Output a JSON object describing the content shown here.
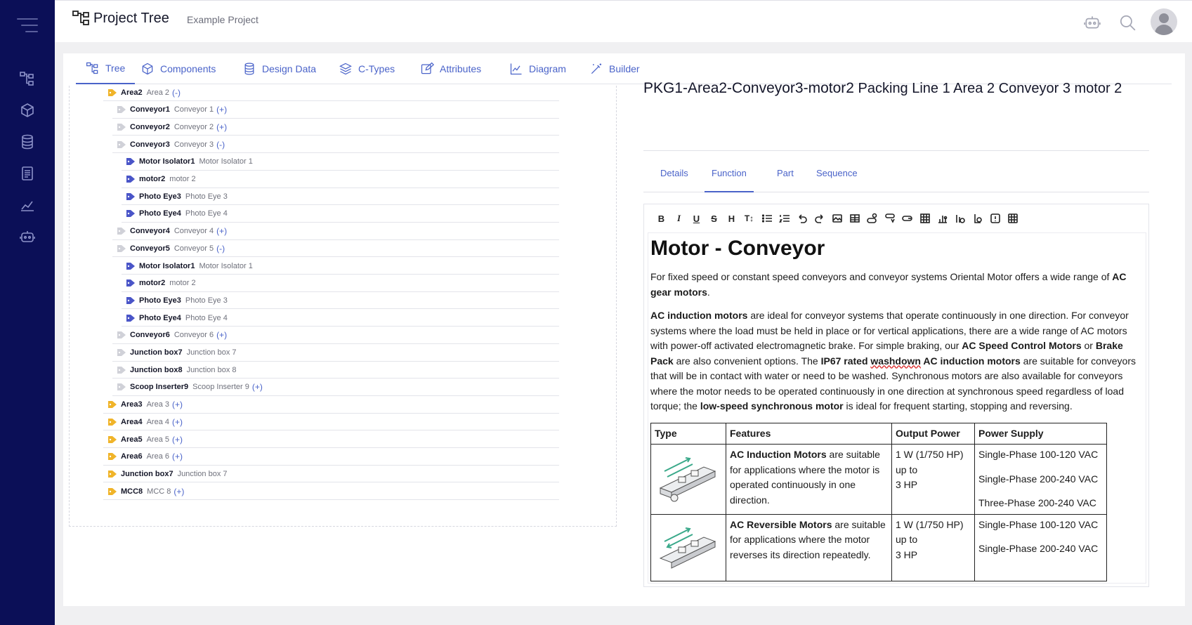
{
  "header": {
    "app_title": "Project Tree",
    "project_name": "Example Project",
    "icons": [
      "tree-logo-icon",
      "robot-icon",
      "search-icon",
      "user-avatar"
    ]
  },
  "sidebar": {
    "icons": [
      "menu-icon",
      "tree-icon",
      "cube-icon",
      "database-icon",
      "document-icon",
      "chart-icon",
      "robot-icon"
    ]
  },
  "tabs": [
    {
      "label": "Tree",
      "icon": "tree-icon",
      "active": true
    },
    {
      "label": "Components",
      "icon": "cube-icon"
    },
    {
      "label": "Design Data",
      "icon": "database-icon"
    },
    {
      "label": "C-Types",
      "icon": "layers-icon"
    },
    {
      "label": "Attributes",
      "icon": "edit-icon"
    },
    {
      "label": "Diagram",
      "icon": "chart-icon"
    },
    {
      "label": "Builder",
      "icon": "wand-icon"
    }
  ],
  "tree": [
    {
      "name": "Area2",
      "desc": "Area 2",
      "toggle": "(-)",
      "tag": "orange"
    },
    {
      "name": "Conveyor1",
      "desc": "Conveyor 1",
      "toggle": "(+)",
      "tag": "grey"
    },
    {
      "name": "Conveyor2",
      "desc": "Conveyor 2",
      "toggle": "(+)",
      "tag": "grey"
    },
    {
      "name": "Conveyor3",
      "desc": "Conveyor 3",
      "toggle": "(-)",
      "tag": "grey"
    },
    {
      "name": "Motor Isolator1",
      "desc": "Motor Isolator 1",
      "toggle": "",
      "tag": "blue"
    },
    {
      "name": "motor2",
      "desc": "motor 2",
      "toggle": "",
      "tag": "blue"
    },
    {
      "name": "Photo Eye3",
      "desc": "Photo Eye 3",
      "toggle": "",
      "tag": "blue"
    },
    {
      "name": "Photo Eye4",
      "desc": "Photo Eye 4",
      "toggle": "",
      "tag": "blue"
    },
    {
      "name": "Conveyor4",
      "desc": "Conveyor 4",
      "toggle": "(+)",
      "tag": "grey"
    },
    {
      "name": "Conveyor5",
      "desc": "Conveyor 5",
      "toggle": "(-)",
      "tag": "grey"
    },
    {
      "name": "Motor Isolator1",
      "desc": "Motor Isolator 1",
      "toggle": "",
      "tag": "blue"
    },
    {
      "name": "motor2",
      "desc": "motor 2",
      "toggle": "",
      "tag": "blue"
    },
    {
      "name": "Photo Eye3",
      "desc": "Photo Eye 3",
      "toggle": "",
      "tag": "blue"
    },
    {
      "name": "Photo Eye4",
      "desc": "Photo Eye 4",
      "toggle": "",
      "tag": "blue"
    },
    {
      "name": "Conveyor6",
      "desc": "Conveyor 6",
      "toggle": "(+)",
      "tag": "grey"
    },
    {
      "name": "Junction box7",
      "desc": "Junction box 7",
      "toggle": "",
      "tag": "grey"
    },
    {
      "name": "Junction box8",
      "desc": "Junction box 8",
      "toggle": "",
      "tag": "grey"
    },
    {
      "name": "Scoop Inserter9",
      "desc": "Scoop Inserter 9",
      "toggle": "(+)",
      "tag": "grey"
    },
    {
      "name": "Area3",
      "desc": "Area 3",
      "toggle": "(+)",
      "tag": "orange"
    },
    {
      "name": "Area4",
      "desc": "Area 4",
      "toggle": "(+)",
      "tag": "orange"
    },
    {
      "name": "Area5",
      "desc": "Area 5",
      "toggle": "(+)",
      "tag": "orange"
    },
    {
      "name": "Area6",
      "desc": "Area 6",
      "toggle": "(+)",
      "tag": "orange"
    },
    {
      "name": "Junction box7",
      "desc": "Junction box 7",
      "toggle": "",
      "tag": "orange"
    },
    {
      "name": "MCC8",
      "desc": "MCC 8",
      "toggle": "(+)",
      "tag": "orange"
    }
  ],
  "detail": {
    "code": "PKG1-Area2-Conveyor3-motor2",
    "description": "Packing Line 1 Area 2 Conveyor 3 motor 2",
    "subtabs": [
      "Details",
      "Function",
      "Part",
      "Sequence"
    ],
    "active_subtab": "Function",
    "toolbar": [
      "B",
      "I",
      "U",
      "S",
      "H",
      "T↕",
      "bullet-list-icon",
      "numbered-list-icon",
      "undo-icon",
      "redo-icon",
      "image-icon",
      "table-icon",
      "insert-icon",
      "insert-icon",
      "insert-icon",
      "grid-icon",
      "chart-icon",
      "chart-icon",
      "tag-icon",
      "info-icon",
      "table-edit-icon"
    ],
    "heading": "Motor - Conveyor",
    "p1_a": "For fixed speed or constant speed conveyors and conveyor systems Oriental Motor offers a wide range of ",
    "p1_b": "AC gear motors",
    "p1_c": ".",
    "p2": {
      "s1": "AC induction motors",
      "s2": " are ideal for conveyor systems that operate continuously in one direction. For conveyor systems where the load must be held in place or for vertical applications, there are a wide range of AC motors with power-off activated electromagnetic brake. For simple braking, our ",
      "s3": "AC Speed Control Motors",
      "s4": " or ",
      "s5": "Brake Pack",
      "s6": " are also convenient options. The ",
      "s7": "IP67 rated ",
      "s8": "washdown",
      "s9": " AC induction motors",
      "s10": " are suitable for conveyors that will be in contact with water or need to be washed. Synchronous motors are also available for conveyors where the motor needs to be operated continuously in one direction at synchronous speed regardless of load torque; the ",
      "s11": "low-speed synchronous motor",
      "s12": " is ideal for frequent starting, stopping and reversing."
    },
    "table": {
      "headers": [
        "Type",
        "Features",
        "Output Power",
        "Power Supply"
      ],
      "rows": [
        {
          "feature_bold": "AC Induction Motors",
          "feature_rest": " are suitable for applications where the motor is operated continuously in one direction.",
          "power": [
            "1 W (1/750 HP)",
            "up to",
            "3 HP"
          ],
          "supply": [
            "Single-Phase 100-120 VAC",
            "Single-Phase 200-240 VAC",
            "Three-Phase 200-240 VAC"
          ]
        },
        {
          "feature_bold": "AC Reversible Motors",
          "feature_rest": " are suitable for applications where the motor reverses its direction repeatedly.",
          "power": [
            "1 W (1/750 HP)",
            "up to",
            "3 HP"
          ],
          "supply": [
            "Single-Phase 100-120 VAC",
            "Single-Phase 200-240 VAC"
          ]
        }
      ]
    }
  },
  "colors": {
    "sidebar": "#0b0f57",
    "accent": "#4a63c9",
    "tag_orange": "#f0b429",
    "tag_blue": "#4a55c8",
    "tag_grey": "#d0d1d8",
    "conveyor_arrow": "#3aa98a"
  }
}
